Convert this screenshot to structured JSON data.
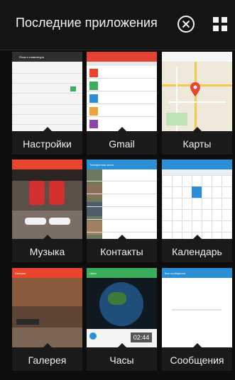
{
  "header": {
    "title": "Последние приложения"
  },
  "apps": [
    {
      "label": "Настройки",
      "shot": {
        "title": "Язык и клавиатура"
      }
    },
    {
      "label": "Gmail",
      "shot": {}
    },
    {
      "label": "Карты",
      "shot": {}
    },
    {
      "label": "Музыка",
      "shot": {}
    },
    {
      "label": "Контакты",
      "shot": {
        "title": "Телефонная книга"
      }
    },
    {
      "label": "Календарь",
      "shot": {}
    },
    {
      "label": "Галерея",
      "shot": {
        "title": "Галерея"
      }
    },
    {
      "label": "Часы",
      "shot": {
        "title": "Часы",
        "time": "02:44"
      }
    },
    {
      "label": "Сообщения",
      "shot": {
        "title": "Все сообщения"
      }
    }
  ],
  "colors": {
    "accent_red": "#e8452c",
    "accent_blue": "#2b8fd6",
    "accent_green": "#3aae5a"
  }
}
